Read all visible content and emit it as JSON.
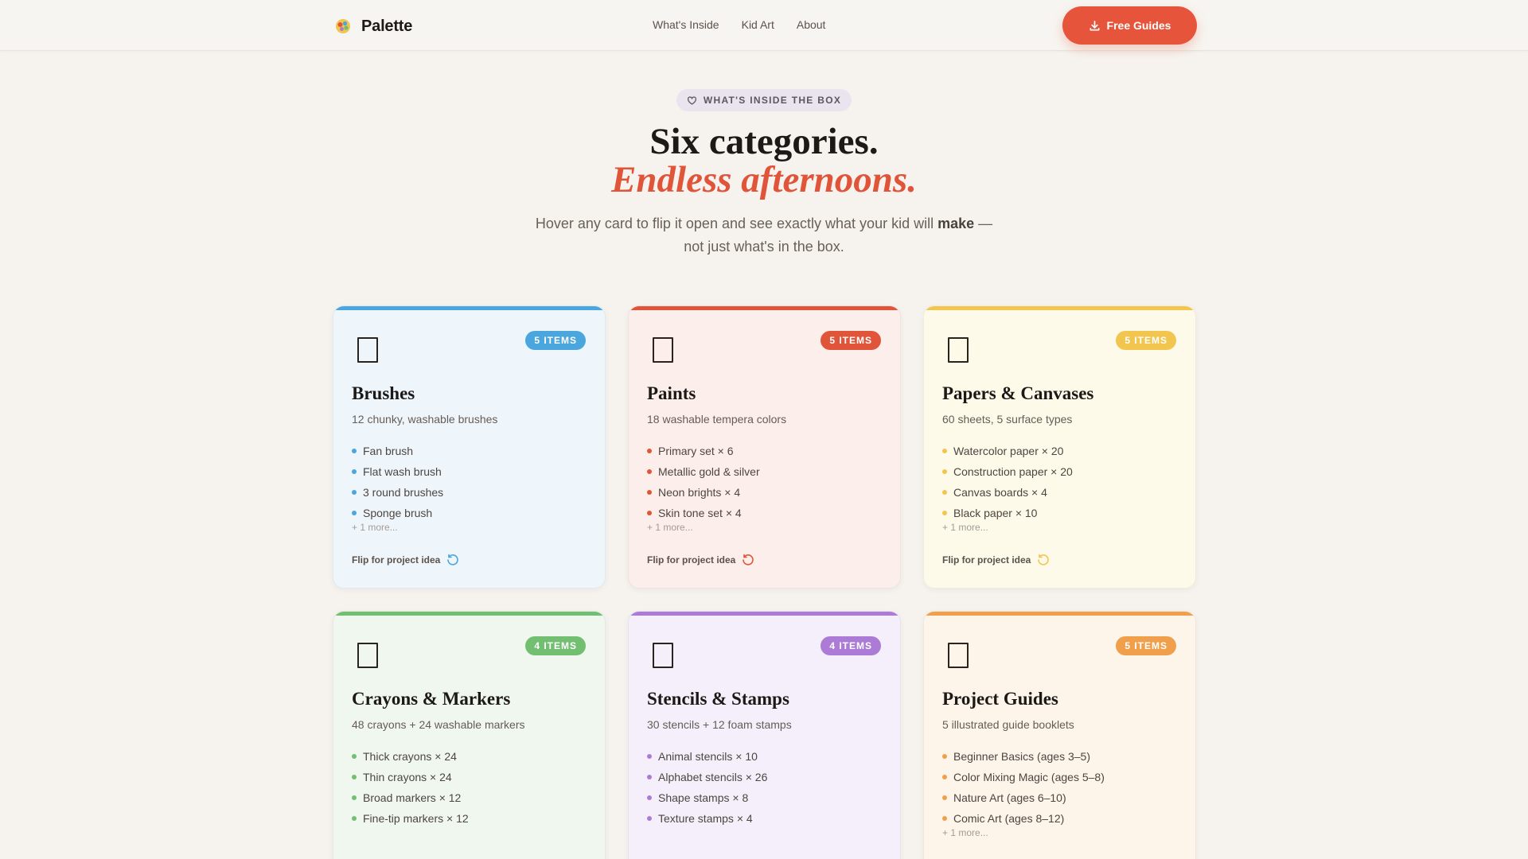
{
  "nav": {
    "brand": "Palette",
    "links": [
      "What's Inside",
      "Kid Art",
      "About"
    ],
    "cta_label": "Free Guides"
  },
  "hero": {
    "eyebrow": "WHAT'S INSIDE THE BOX",
    "title": "Six categories.",
    "title_accent": "Endless afternoons.",
    "subtitle_pre": "Hover any card to flip it open and see exactly what your kid will",
    "subtitle_bold": "make",
    "subtitle_post": "— not just what's in the box."
  },
  "cards": [
    {
      "badge": "5 ITEMS",
      "title": "Brushes",
      "desc": "12 chunky, washable brushes",
      "items": [
        "Fan brush",
        "Flat wash brush",
        "3 round brushes",
        "Sponge brush"
      ],
      "more": "+ 1 more...",
      "flip_label": "Flip for project idea",
      "accent": "#4aa6dc",
      "bg": "#eef6fc"
    },
    {
      "badge": "5 ITEMS",
      "title": "Paints",
      "desc": "18 washable tempera colors",
      "items": [
        "Primary set × 6",
        "Metallic gold & silver",
        "Neon brights × 4",
        "Skin tone set × 4"
      ],
      "more": "+ 1 more...",
      "flip_label": "Flip for project idea",
      "accent": "#e0553a",
      "bg": "#fcefeb"
    },
    {
      "badge": "5 ITEMS",
      "title": "Papers & Canvases",
      "desc": "60 sheets, 5 surface types",
      "items": [
        "Watercolor paper × 20",
        "Construction paper × 20",
        "Canvas boards × 4",
        "Black paper × 10"
      ],
      "more": "+ 1 more...",
      "flip_label": "Flip for project idea",
      "accent": "#f2c54e",
      "bg": "#fefaea"
    },
    {
      "badge": "4 ITEMS",
      "title": "Crayons & Markers",
      "desc": "48 crayons + 24 washable markers",
      "items": [
        "Thick crayons × 24",
        "Thin crayons × 24",
        "Broad markers × 12",
        "Fine-tip markers × 12"
      ],
      "more": "",
      "flip_label": "",
      "accent": "#72bf72",
      "bg": "#eff7ef"
    },
    {
      "badge": "4 ITEMS",
      "title": "Stencils & Stamps",
      "desc": "30 stencils + 12 foam stamps",
      "items": [
        "Animal stencils × 10",
        "Alphabet stencils × 26",
        "Shape stamps × 8",
        "Texture stamps × 4"
      ],
      "more": "",
      "flip_label": "",
      "accent": "#ab7bd6",
      "bg": "#f4effb"
    },
    {
      "badge": "5 ITEMS",
      "title": "Project Guides",
      "desc": "5 illustrated guide booklets",
      "items": [
        "Beginner Basics (ages 3–5)",
        "Color Mixing Magic (ages 5–8)",
        "Nature Art (ages 6–10)",
        "Comic Art (ages 8–12)"
      ],
      "more": "+ 1 more...",
      "flip_label": "",
      "accent": "#f0a04b",
      "bg": "#fdf4ea"
    }
  ]
}
